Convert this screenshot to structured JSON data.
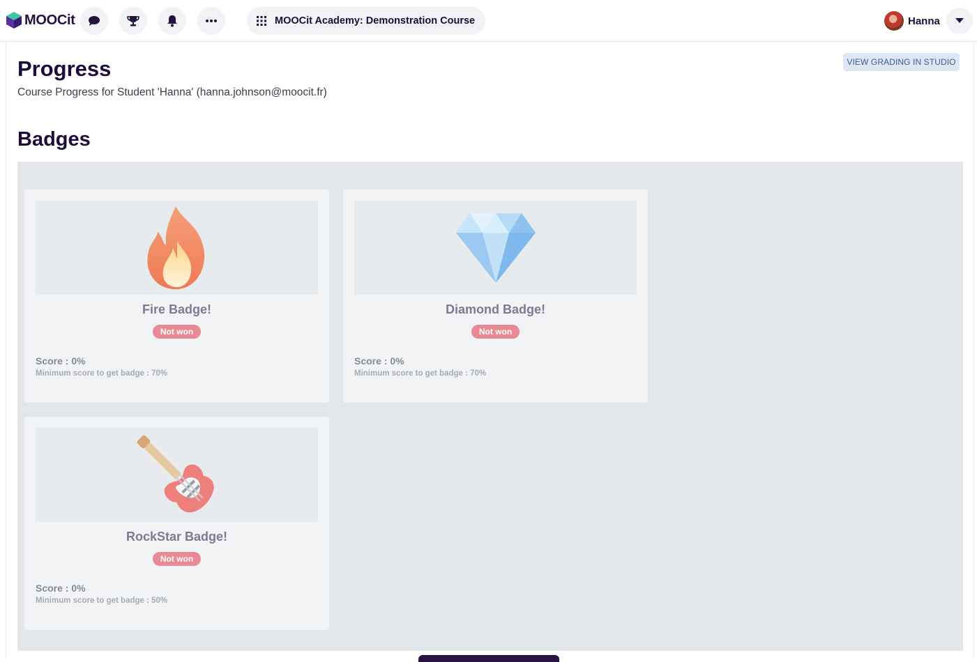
{
  "header": {
    "logo_text": "MOOCit",
    "icons": [
      "chat-icon",
      "trophy-icon",
      "bell-icon",
      "more-icon"
    ],
    "course_title": "MOOCit Academy: Demonstration Course",
    "user_name": "Hanna"
  },
  "main": {
    "title": "Progress",
    "subtitle": "Course Progress for Student 'Hanna' (hanna.johnson@moocit.fr)",
    "studio_button": "VIEW GRADING IN STUDIO",
    "badges_title": "Badges",
    "badges": [
      {
        "name": "Fire Badge!",
        "icon": "fire-icon",
        "status": "Not won",
        "score": "Score : 0%",
        "minimum": "Minimum score to get badge : 70%"
      },
      {
        "name": "Diamond Badge!",
        "icon": "diamond-icon",
        "status": "Not won",
        "score": "Score : 0%",
        "minimum": "Minimum score to get badge : 70%"
      },
      {
        "name": "RockStar Badge!",
        "icon": "guitar-icon",
        "status": "Not won",
        "score": "Score : 0%",
        "minimum": "Minimum score to get badge : 50%"
      }
    ]
  },
  "colors": {
    "brand_dark": "#1d0b3a",
    "badge_not_won": "#e88a95",
    "studio_button_bg": "#dde7f5"
  }
}
